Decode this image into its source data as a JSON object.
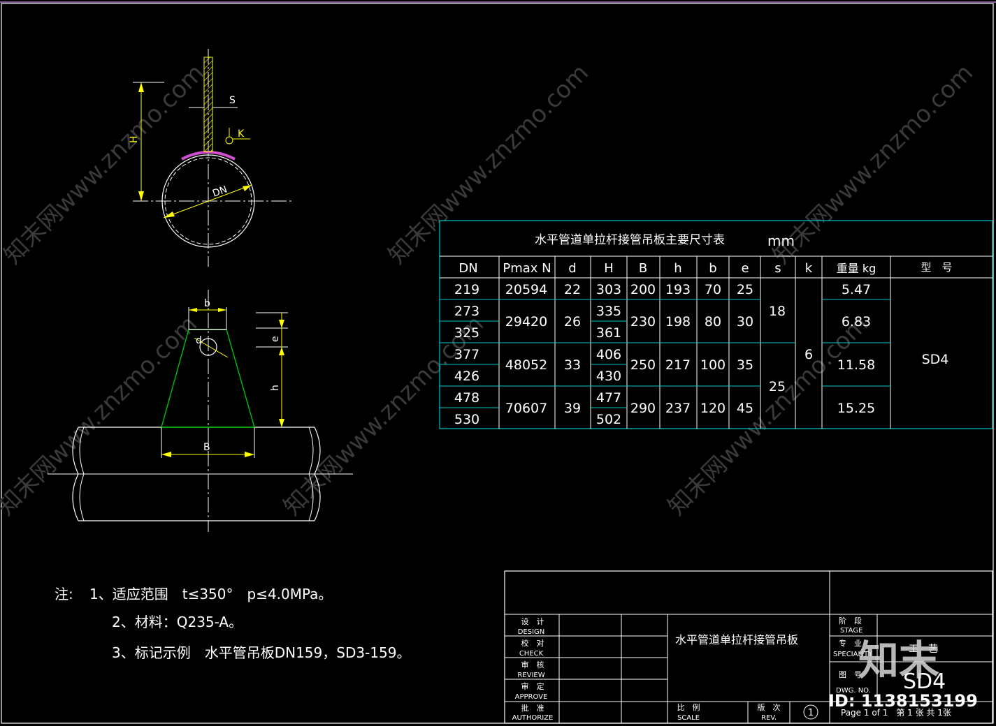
{
  "watermark": "知末网www.znzmo.com",
  "brand": {
    "logo_text": "知末",
    "id_label": "ID: 1138153199"
  },
  "top_view": {
    "labels": {
      "s": "S",
      "k": "K",
      "H": "H",
      "DN": "DN"
    }
  },
  "front_view": {
    "labels": {
      "b": "b",
      "d": "d",
      "e": "e",
      "h": "h",
      "B": "B"
    }
  },
  "table": {
    "title": "水平管道单拉杆接管吊板主要尺寸表",
    "unit": "mm",
    "headers": [
      "DN",
      "Pmax N",
      "d",
      "H",
      "B",
      "h",
      "b",
      "e",
      "s",
      "k",
      "重量 kg",
      "型　号"
    ],
    "rows": [
      {
        "dn": "219",
        "pmax": "20594",
        "d": "22",
        "H": "303",
        "B": "200",
        "h": "193",
        "b": "70",
        "e": "25",
        "kg": "5.47"
      },
      {
        "dn": "273",
        "pmax": "29420",
        "d": "26",
        "H": "335",
        "B": "230",
        "h": "198",
        "b": "80",
        "e": "30",
        "kg": "6.83"
      },
      {
        "dn": "325",
        "H": "361"
      },
      {
        "dn": "377",
        "pmax": "48052",
        "d": "33",
        "H": "406",
        "B": "250",
        "h": "217",
        "b": "100",
        "e": "35",
        "kg": "11.58"
      },
      {
        "dn": "426",
        "H": "430"
      },
      {
        "dn": "478",
        "pmax": "70607",
        "d": "39",
        "H": "477",
        "B": "290",
        "h": "237",
        "b": "120",
        "e": "45",
        "kg": "15.25"
      },
      {
        "dn": "530",
        "H": "502"
      }
    ],
    "s_values": [
      "18",
      "25"
    ],
    "k_value": "6",
    "model": "SD4"
  },
  "notes": {
    "prefix": "注:",
    "lines": [
      "1、适应范围　t≤350°　p≤4.0MPa。",
      "2、材料：Q235-A。",
      "3、标记示例　水平管吊板DN159，SD3-159。"
    ]
  },
  "title_block": {
    "roles": [
      {
        "cn": "设　计",
        "en": "DESIGN"
      },
      {
        "cn": "校　对",
        "en": "CHECK"
      },
      {
        "cn": "审　核",
        "en": "REVIEW"
      },
      {
        "cn": "审　定",
        "en": "APPROVE"
      },
      {
        "cn": "批　准",
        "en": "AUTHORIZE"
      }
    ],
    "drawing_title": "水平管道单拉杆接管吊板",
    "stage": {
      "cn": "阶　段",
      "en": "STAGE"
    },
    "specialty": {
      "cn": "专　业",
      "en": "SPECIALITY",
      "value": "工　艺"
    },
    "dwg_no": {
      "cn": "图　号",
      "en": "DWG. NO.",
      "value": "SD4"
    },
    "scale": {
      "cn": "比　例",
      "en": "SCALE"
    },
    "rev": {
      "cn": "版　次",
      "en": "REV.",
      "value": "1"
    },
    "page": "Page 1 of 1　第 1 张 共 1张"
  }
}
